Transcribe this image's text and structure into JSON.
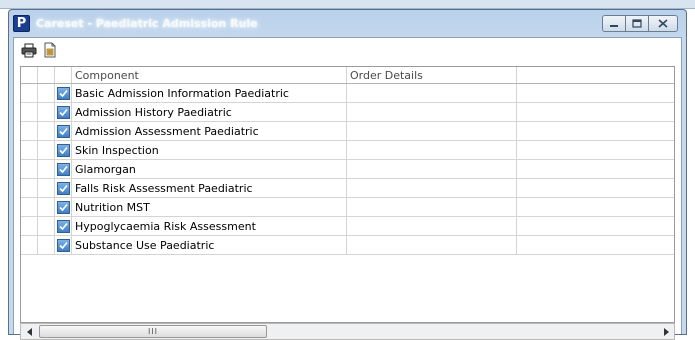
{
  "window": {
    "app_icon_letter": "P",
    "title": "Careset - Paediatric Admission Rule",
    "controls": [
      "minimize-icon",
      "maximize-icon",
      "close-icon"
    ]
  },
  "toolbar": {
    "buttons": [
      "print-icon",
      "export-icon"
    ]
  },
  "grid": {
    "columns": [
      "Component",
      "Order Details"
    ],
    "rows": [
      {
        "component": "Basic Admission Information Paediatric",
        "order_details": "",
        "checked": true
      },
      {
        "component": "Admission History Paediatric",
        "order_details": "",
        "checked": true
      },
      {
        "component": "Admission Assessment Paediatric",
        "order_details": "",
        "checked": true
      },
      {
        "component": "Skin Inspection",
        "order_details": "",
        "checked": true
      },
      {
        "component": "Glamorgan",
        "order_details": "",
        "checked": true
      },
      {
        "component": "Falls Risk Assessment Paediatric",
        "order_details": "",
        "checked": true
      },
      {
        "component": "Nutrition MST",
        "order_details": "",
        "checked": true
      },
      {
        "component": "Hypoglycaemia Risk Assessment",
        "order_details": "",
        "checked": true
      },
      {
        "component": "Substance Use Paediatric",
        "order_details": "",
        "checked": true
      }
    ]
  },
  "scrollbar": {
    "grip": "III"
  },
  "colors": {
    "title_bar": "#b9d1ea",
    "checkbox": "#3f7fc4",
    "app_icon": "#1a3f8f"
  }
}
